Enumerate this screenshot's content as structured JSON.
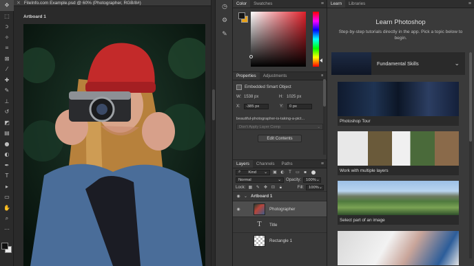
{
  "document": {
    "tab_title": "FileInfo.com Example.psd @ 60% (Photographer, RGB/8#)",
    "artboard_label": "Artboard 1"
  },
  "toolbar": {
    "tools": [
      "move",
      "marquee",
      "lasso",
      "magic-wand",
      "crop",
      "frame",
      "eyedropper",
      "healing",
      "brush",
      "clone-stamp",
      "history-brush",
      "eraser",
      "gradient",
      "blur",
      "dodge",
      "pen",
      "type",
      "path-select",
      "rectangle",
      "hand",
      "zoom",
      "more"
    ]
  },
  "color_panel": {
    "tabs": [
      "Color",
      "Swatches"
    ],
    "foreground": "#151515",
    "background": "#e8a21a"
  },
  "properties_panel": {
    "tabs": [
      "Properties",
      "Adjustments"
    ],
    "object_type": "Embedded Smart Object",
    "w_label": "W:",
    "w_value": "1538 px",
    "h_label": "H:",
    "h_value": "1025 px",
    "x_label": "X:",
    "x_value": "-385 px",
    "y_label": "Y:",
    "y_value": "0 px",
    "filename": "beautiful-photographer-is-taking-a-pict...",
    "layer_comp": "Don't Apply Layer Comp",
    "edit_button": "Edit Contents"
  },
  "layers_panel": {
    "tabs": [
      "Layers",
      "Channels",
      "Paths"
    ],
    "filter_kind": "Kind",
    "blend_mode": "Normal",
    "opacity_label": "Opacity:",
    "opacity_value": "100%",
    "lock_label": "Lock:",
    "fill_label": "Fill:",
    "fill_value": "100%",
    "layers": [
      {
        "name": "Artboard 1"
      },
      {
        "name": "Photographer"
      },
      {
        "name": "Title"
      },
      {
        "name": "Rectangle 1"
      }
    ]
  },
  "learn_panel": {
    "tabs": [
      "Learn",
      "Libraries"
    ],
    "title": "Learn Photoshop",
    "subtitle": "Step-by-step tutorials directly in the app. Pick a topic below to begin.",
    "section": "Fundamental Skills",
    "cards": [
      "Photoshop Tour",
      "Work with multiple layers",
      "Select part of an image"
    ]
  }
}
